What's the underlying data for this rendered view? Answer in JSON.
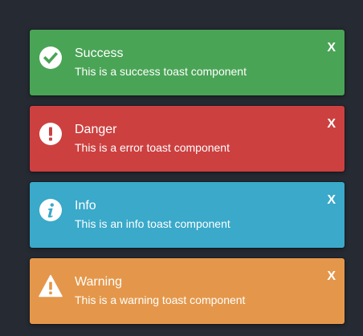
{
  "toasts": [
    {
      "type": "success",
      "title": "Success",
      "message": "This is a success toast component",
      "close_label": "X",
      "icon": "check-circle-icon",
      "color": "#4aa456"
    },
    {
      "type": "danger",
      "title": "Danger",
      "message": "This is a error toast component",
      "close_label": "X",
      "icon": "exclamation-circle-icon",
      "color": "#cd4040"
    },
    {
      "type": "info",
      "title": "Info",
      "message": "This is an info toast component",
      "close_label": "X",
      "icon": "info-circle-icon",
      "color": "#3aa9ca"
    },
    {
      "type": "warning",
      "title": "Warning",
      "message": "This is a warning toast component",
      "close_label": "X",
      "icon": "warning-triangle-icon",
      "color": "#e4974a"
    }
  ]
}
